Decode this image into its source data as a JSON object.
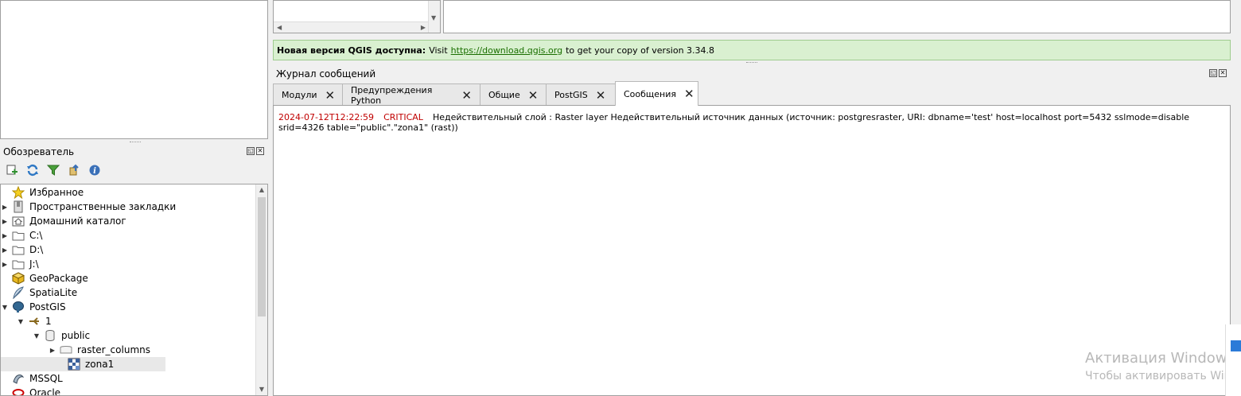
{
  "browser": {
    "title": "Обозреватель",
    "toolbar": [
      {
        "name": "add-layer-icon",
        "color": "#2f8f2f"
      },
      {
        "name": "refresh-icon",
        "color": "#2f78c4"
      },
      {
        "name": "filter-icon",
        "color": "#4aa03a"
      },
      {
        "name": "collapse-all-icon",
        "color": "#3a70b8"
      },
      {
        "name": "info-icon",
        "color": "#3a70b8"
      }
    ],
    "tree": {
      "favorites": "Избранное",
      "spatial_bookmarks": "Пространственные закладки",
      "home": "Домашний каталог",
      "drive_c": "C:\\",
      "drive_d": "D:\\",
      "drive_j": "J:\\",
      "geopackage": "GeoPackage",
      "spatialite": "SpatiaLite",
      "postgis": "PostGIS",
      "connection": "1",
      "schema": "public",
      "raster_columns": "raster_columns",
      "zona1": "zona1",
      "mssql": "MSSQL",
      "oracle": "Oracle"
    }
  },
  "banner": {
    "bold": "Новая версия QGIS доступна:",
    "pre": "Visit",
    "link": "https://download.qgis.org",
    "post": "to get your copy of version 3.34.8"
  },
  "log": {
    "title": "Журнал сообщений",
    "tabs": [
      {
        "label": "Модули"
      },
      {
        "label": "Предупреждения Python"
      },
      {
        "label": "Общие"
      },
      {
        "label": "PostGIS"
      },
      {
        "label": "Сообщения"
      }
    ],
    "entry": {
      "timestamp": "2024-07-12T12:22:59",
      "level": "CRITICAL",
      "message": "Недействительный слой : Raster layer Недействительный источник данных (источник: postgresraster, URI: dbname='test' host=localhost port=5432 sslmode=disable srid=4326 table=\"public\".\"zona1\" (rast))"
    }
  },
  "watermark": {
    "line1": "Активация Windows",
    "line2": "Чтобы активировать Windows"
  }
}
